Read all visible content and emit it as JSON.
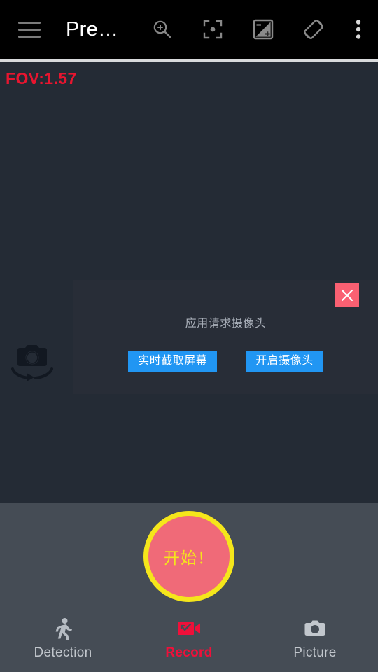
{
  "appbar": {
    "menu_icon": "hamburger-menu-icon",
    "title": "Pre…",
    "actions": [
      {
        "name": "zoom-in-icon",
        "label": "Zoom"
      },
      {
        "name": "focus-point-icon",
        "label": "Focus"
      },
      {
        "name": "exposure-compensation-icon",
        "label": "Exposure"
      },
      {
        "name": "screen-rotation-icon",
        "label": "Rotate"
      },
      {
        "name": "overflow-menu-icon",
        "label": "More options"
      }
    ]
  },
  "preview": {
    "fov_label": "FOV:1.57",
    "fov_color": "#e8152f",
    "background_color": "#242b35",
    "switch_camera_icon": "switch-camera-icon"
  },
  "dialog": {
    "message": "应用请求摄像头",
    "close_label": "×",
    "close_color": "#fa6072",
    "button_color": "#2196f3",
    "buttons": [
      {
        "label": "实时截取屏幕"
      },
      {
        "label": "开启摄像头"
      }
    ]
  },
  "record_button": {
    "label": "开始！",
    "fill_color": "#f06a78",
    "border_color": "#f5e61b"
  },
  "tabbar": {
    "active_color": "#f0103a",
    "inactive_color": "#c2c7cd",
    "tabs": [
      {
        "label": "Detection",
        "icon": "running-person-icon",
        "active": false
      },
      {
        "label": "Record",
        "icon": "video-record-icon",
        "active": true
      },
      {
        "label": "Picture",
        "icon": "camera-icon",
        "active": false
      }
    ]
  }
}
